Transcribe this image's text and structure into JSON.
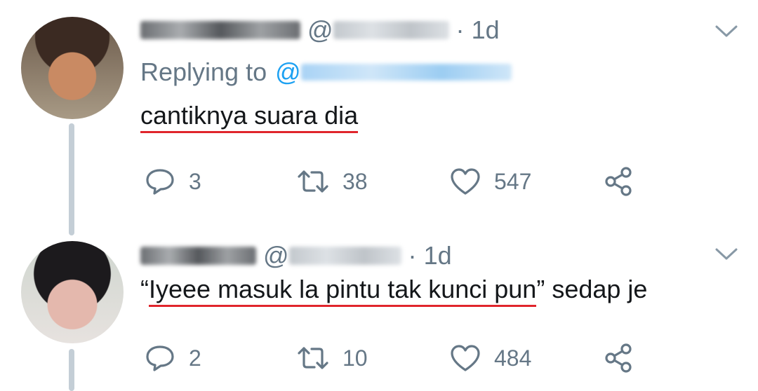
{
  "tweets": [
    {
      "time": "1d",
      "dot": "·",
      "at": "@",
      "replying_label": "Replying to",
      "replying_at": "@",
      "text_underlined": "cantiknya suara dia",
      "text_rest": "",
      "reply_count": "3",
      "retweet_count": "38",
      "like_count": "547"
    },
    {
      "time": "1d",
      "dot": "·",
      "at": "@",
      "text_prefix": "“",
      "text_underlined": "Iyeee masuk la pintu tak kunci pun",
      "text_rest": "” sedap je",
      "reply_count": "2",
      "retweet_count": "10",
      "like_count": "484"
    }
  ],
  "colors": {
    "secondary_text": "#657786",
    "link_blue": "#1da1f2",
    "thread_line": "#c4ced6",
    "underline_red": "#e0252c"
  },
  "icons": [
    "reply-icon",
    "retweet-icon",
    "like-icon",
    "share-icon",
    "chevron-down-icon"
  ]
}
